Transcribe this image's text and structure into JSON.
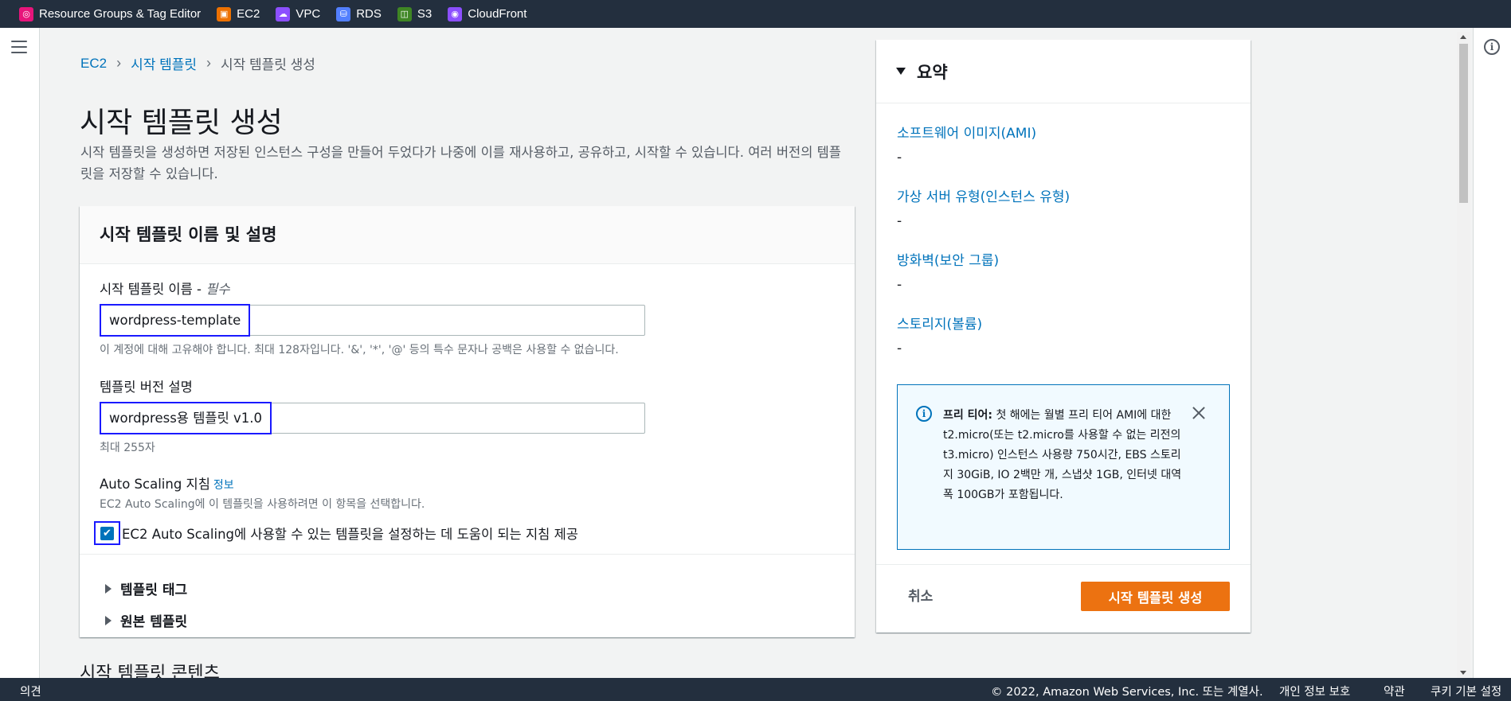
{
  "favorites": [
    {
      "label": "Resource Groups & Tag Editor",
      "icon": "resource-groups-icon",
      "color": "#e7157b"
    },
    {
      "label": "EC2",
      "icon": "ec2-icon",
      "color": "#ed7100"
    },
    {
      "label": "VPC",
      "icon": "vpc-icon",
      "color": "#8c4fff"
    },
    {
      "label": "RDS",
      "icon": "rds-icon",
      "color": "#527fff"
    },
    {
      "label": "S3",
      "icon": "s3-icon",
      "color": "#3f8624"
    },
    {
      "label": "CloudFront",
      "icon": "cloudfront-icon",
      "color": "#8c4fff"
    }
  ],
  "breadcrumb": {
    "root": "EC2",
    "parent": "시작 템플릿",
    "current": "시작 템플릿 생성"
  },
  "page": {
    "title": "시작 템플릿 생성",
    "description": "시작 템플릿을 생성하면 저장된 인스턴스 구성을 만들어 두었다가 나중에 이를 재사용하고, 공유하고, 시작할 수 있습니다. 여러 버전의 템플릿을 저장할 수 있습니다."
  },
  "form": {
    "section_title": "시작 템플릿 이름 및 설명",
    "name_label": "시작 템플릿 이름 - ",
    "name_required": "필수",
    "name_value": "wordpress-template",
    "name_hint": "이 계정에 대해 고유해야 합니다. 최대 128자입니다. '&', '*', '@' 등의 특수 문자나 공백은 사용할 수 없습니다.",
    "version_label": "템플릿 버전 설명",
    "version_value": "wordpress용 템플릿 v1.0",
    "version_hint": "최대 255자",
    "asg_label": "Auto Scaling 지침",
    "asg_info": "정보",
    "asg_hint": "EC2 Auto Scaling에 이 템플릿을 사용하려면 이 항목을 선택합니다.",
    "asg_checkbox_label": "EC2 Auto Scaling에 사용할 수 있는 템플릿을 설정하는 데 도움이 되는 지침 제공",
    "asg_checked": true,
    "expanders": [
      "템플릿 태그",
      "원본 템플릿"
    ]
  },
  "next_section_title": "시작 템플릿 콘텐츠",
  "summary": {
    "title": "요약",
    "items": [
      {
        "label": "소프트웨어 이미지(AMI)",
        "value": "-"
      },
      {
        "label": "가상 서버 유형(인스턴스 유형)",
        "value": "-"
      },
      {
        "label": "방화벽(보안 그룹)",
        "value": "-"
      },
      {
        "label": "스토리지(볼륨)",
        "value": "-"
      }
    ],
    "free_tier_title": "프리 티어:",
    "free_tier_text": " 첫 해에는 월별 프리 티어 AMI에 대한 t2.micro(또는 t2.micro를 사용할 수 없는 리전의 t3.micro) 인스턴스 사용량 750시간, EBS 스토리지 30GiB, IO 2백만 개, 스냅샷 1GB, 인터넷 대역폭 100GB가 포함됩니다.",
    "cancel_label": "취소",
    "create_label": "시작 템플릿 생성"
  },
  "footer": {
    "feedback": "의견",
    "copyright": "© 2022, Amazon Web Services, Inc. 또는 계열사.",
    "privacy": "개인 정보 보호",
    "terms": "약관",
    "cookie": "쿠키 기본 설정"
  },
  "colors": {
    "accent": "#0073bb",
    "primary_button": "#ec7211",
    "nav_bg": "#232f3e",
    "focus_outline": "#1a1aff"
  }
}
